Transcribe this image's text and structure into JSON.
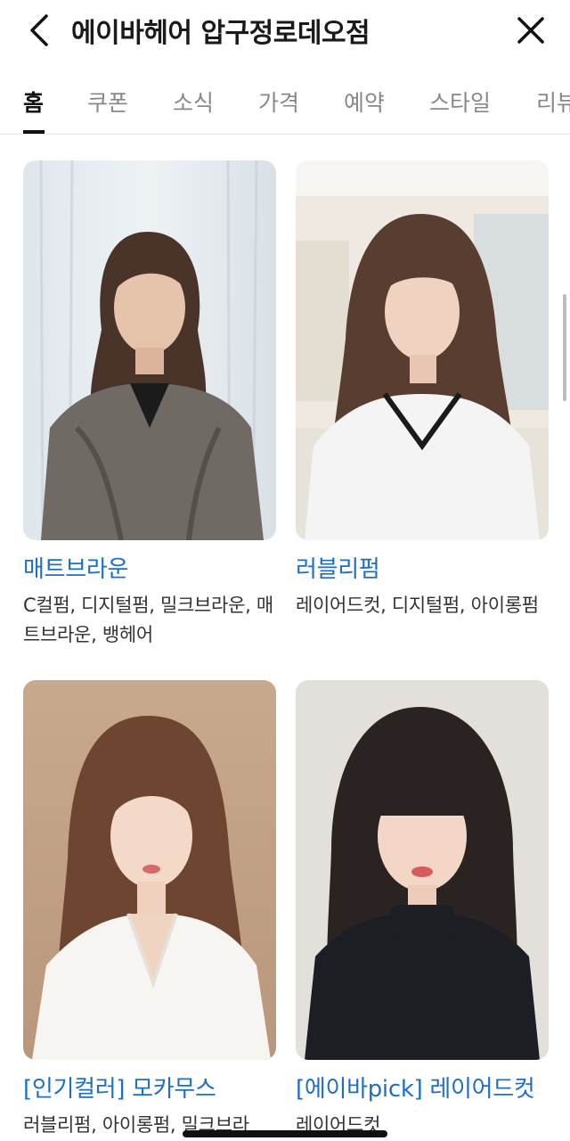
{
  "header": {
    "title": "에이바헤어 압구정로데오점",
    "back_icon": "chevron-left-icon",
    "close_icon": "close-icon"
  },
  "tabs": [
    {
      "label": "홈",
      "active": true
    },
    {
      "label": "쿠폰"
    },
    {
      "label": "소식"
    },
    {
      "label": "가격"
    },
    {
      "label": "예약"
    },
    {
      "label": "스타일"
    },
    {
      "label": "리뷰"
    }
  ],
  "styles": [
    {
      "title": "매트브라운",
      "desc": "C컬펌, 디지털펌, 밀크브라운, 매트브라운, 뱅헤어"
    },
    {
      "title": "러블리펌",
      "desc": "레이어드컷, 디지털펌, 아이롱펌"
    },
    {
      "title": "[인기컬러] 모카무스",
      "desc": "러블리펌, 아이롱펌, 밀크브라"
    },
    {
      "title": "[에이바pick] 레이어드컷",
      "desc": "레이어드컷"
    }
  ]
}
